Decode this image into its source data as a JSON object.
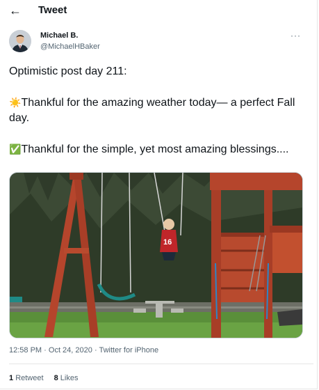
{
  "header": {
    "back_icon": "arrow-left-icon",
    "title": "Tweet"
  },
  "author": {
    "name": "Michael B.",
    "handle": "@MichaelHBaker"
  },
  "more_icon": "more-horizontal-icon",
  "more_glyph": "···",
  "tweet": {
    "line1": "Optimistic post day 211:",
    "sun_emoji": "☀️",
    "line2": "Thankful for the amazing weather today— a perfect Fall day.",
    "check_emoji": "✅",
    "line3": "Thankful for the simple, yet most amazing blessings...."
  },
  "media": {
    "jersey_number": "16"
  },
  "meta": {
    "time": "12:58 PM",
    "date": "Oct 24, 2020",
    "source": "Twitter for iPhone"
  },
  "stats": {
    "retweets_count": "1",
    "retweets_label": "Retweet",
    "likes_count": "8",
    "likes_label": "Likes"
  }
}
